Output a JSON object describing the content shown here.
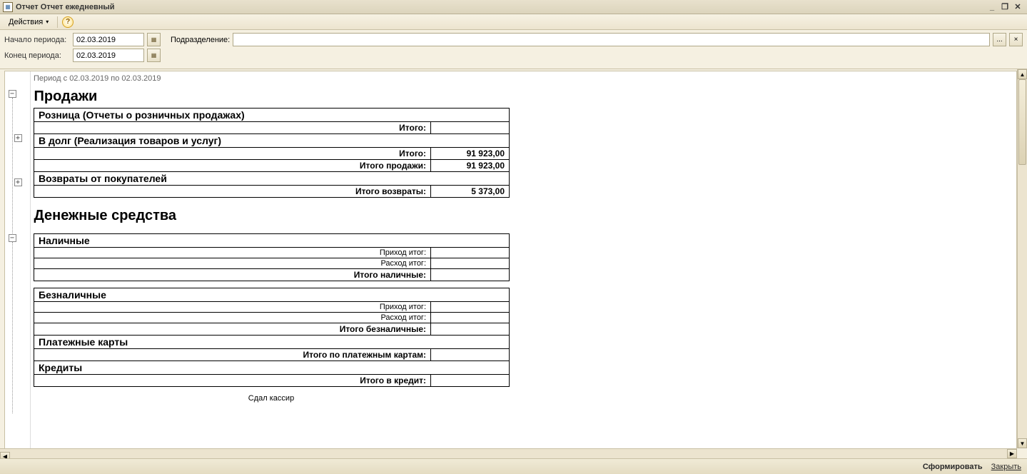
{
  "window": {
    "title": "Отчет  Отчет ежедневный"
  },
  "toolbar": {
    "actions": "Действия"
  },
  "filters": {
    "start_label": "Начало периода:",
    "start_value": "02.03.2019",
    "end_label": "Конец периода:",
    "end_value": "02.03.2019",
    "dept_label": "Подразделение:",
    "dept_value": "",
    "ellipsis": "...",
    "clear": "×"
  },
  "report": {
    "period_text": "Период с 02.03.2019 по 02.03.2019",
    "sales_header": "Продажи",
    "retail_header": "Розница (Отчеты о розничных продажах)",
    "itogo": "Итого:",
    "debt_header": "В долг (Реализация товаров и услуг)",
    "debt_total": "91 923,00",
    "sales_total_label": "Итого продажи:",
    "sales_total": "91 923,00",
    "returns_header": "Возвраты от покупателей",
    "returns_total_label": "Итого возвраты:",
    "returns_total": "5 373,00",
    "money_header": "Денежные средства",
    "cash_header": "Наличные",
    "income_label": "Приход итог:",
    "expense_label": "Расход итог:",
    "cash_total_label": "Итого наличные:",
    "noncash_header": "Безналичные",
    "noncash_total_label": "Итого безналичные:",
    "cards_header": "Платежные карты",
    "cards_total_label": "Итого по платежным картам:",
    "credits_header": "Кредиты",
    "credits_total_label": "Итого в кредит:",
    "signature": "Сдал кассир"
  },
  "footer": {
    "generate": "Сформировать",
    "close": "Закрыть"
  },
  "tree": {
    "minus": "−",
    "plus": "+"
  }
}
